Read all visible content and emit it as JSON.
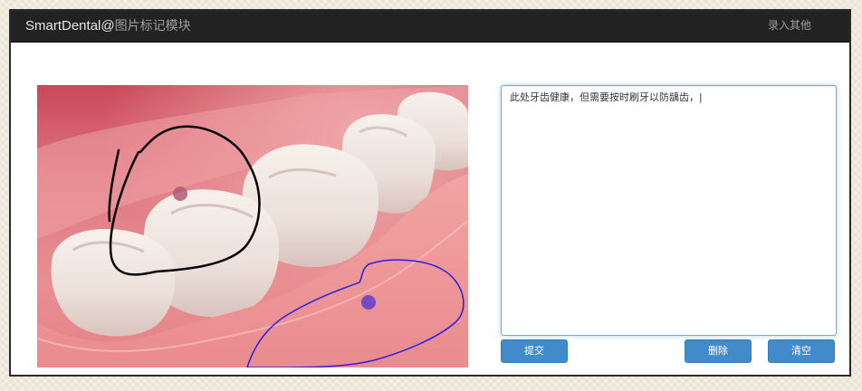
{
  "navbar": {
    "brand_en": "SmartDental@",
    "brand_cn": "图片标记模块",
    "link_other": "录入其他"
  },
  "image": {
    "subject": "teeth-and-gums",
    "marks": [
      {
        "color": "#000000",
        "kind": "freehand-circle"
      },
      {
        "color": "#2a1fe0",
        "kind": "freehand-outline"
      }
    ],
    "dot_colors": [
      "#b05a78",
      "#6a43c4"
    ]
  },
  "annotation": {
    "text": "此处牙齿健康，但需要按时刷牙以防龋齿，|"
  },
  "buttons": {
    "submit": "提交",
    "delete": "删除",
    "clear": "清空"
  },
  "colors": {
    "navbar_bg": "#222222",
    "primary_button": "#428bca",
    "focus_border": "#66afe9"
  }
}
